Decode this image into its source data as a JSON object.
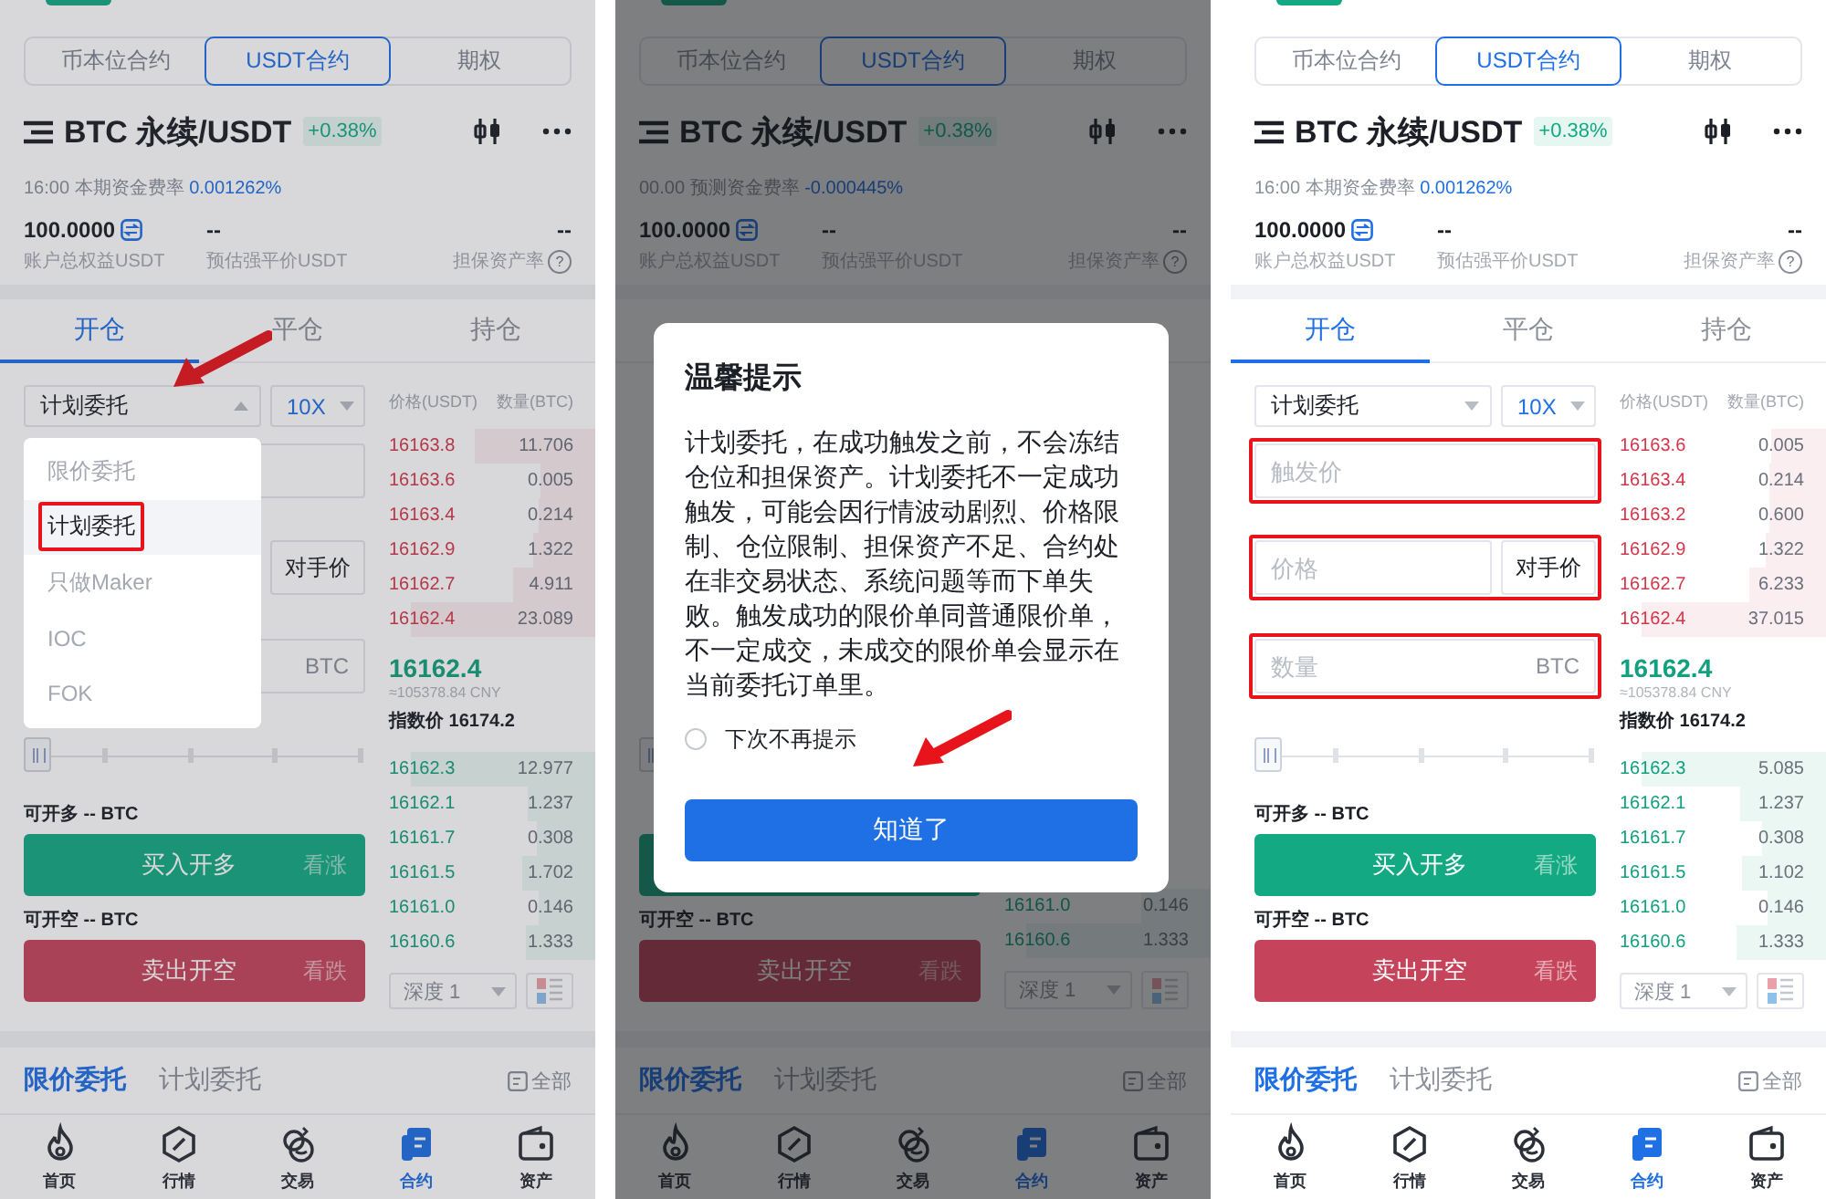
{
  "screens": [
    {
      "market_tabs": [
        {
          "label": "币本位合约",
          "selected": false
        },
        {
          "label": "USDT合约",
          "selected": true
        },
        {
          "label": "期权",
          "selected": false
        }
      ],
      "symbol": "BTC 永续/USDT",
      "change": "+0.38%",
      "funding": {
        "label": "16:00 本期资金费率",
        "rate": "0.001262%"
      },
      "stats": [
        {
          "value": "100.0000",
          "label": "账户总权益USDT"
        },
        {
          "value": "--",
          "label": "预估强平价USDT"
        },
        {
          "value": "--",
          "label": "担保资产率",
          "help": "?"
        }
      ],
      "trade_tabs": [
        {
          "label": "开仓",
          "selected": true
        },
        {
          "label": "平仓",
          "selected": false
        },
        {
          "label": "持仓",
          "selected": false
        }
      ],
      "order_type": {
        "value": "计划委托",
        "open": true,
        "arrow": true
      },
      "leverage": "10X",
      "trigger_field": {
        "highlighted": false
      },
      "price_field": {
        "highlighted": false
      },
      "counter_price": "对手价",
      "amount_field": {
        "unit": "BTC",
        "highlighted": false
      },
      "slider": {
        "level": 0
      },
      "long_available": "可开多 -- BTC",
      "buy": {
        "label": "买入开多",
        "hint": "看涨"
      },
      "short_available": "可开空 -- BTC",
      "sell": {
        "label": "卖出开空",
        "hint": "看跌"
      },
      "book_header": {
        "price": "价格(USDT)",
        "amount": "数量(BTC)"
      },
      "asks": [
        {
          "price": "16163.8",
          "amount": "11.706"
        },
        {
          "price": "16163.6",
          "amount": "0.005"
        },
        {
          "price": "16163.4",
          "amount": "0.214"
        },
        {
          "price": "16162.9",
          "amount": "1.322"
        },
        {
          "price": "16162.7",
          "amount": "4.911"
        },
        {
          "price": "16162.4",
          "amount": "23.089"
        }
      ],
      "last_price": "16162.4",
      "last_price_cny": "≈105378.84 CNY",
      "index_price": "指数价 16174.2",
      "bids": [
        {
          "price": "16162.3",
          "amount": "12.977"
        },
        {
          "price": "16162.1",
          "amount": "1.237"
        },
        {
          "price": "16161.7",
          "amount": "0.308"
        },
        {
          "price": "16161.5",
          "amount": "1.702"
        },
        {
          "price": "16161.0",
          "amount": "0.146"
        },
        {
          "price": "16160.6",
          "amount": "1.333"
        }
      ],
      "depth": "深度 1",
      "order_tabs": [
        {
          "label": "限价委托",
          "selected": true
        },
        {
          "label": "计划委托",
          "selected": false
        }
      ],
      "all_label": "全部",
      "nav": [
        {
          "label": "首页",
          "selected": false
        },
        {
          "label": "行情",
          "selected": false
        },
        {
          "label": "交易",
          "selected": false
        },
        {
          "label": "合约",
          "selected": true
        },
        {
          "label": "资产",
          "selected": false
        }
      ],
      "overlay": {
        "kind": "dropdown",
        "options": [
          {
            "label": "限价委托",
            "selected": false,
            "highlighted": false
          },
          {
            "label": "计划委托",
            "selected": true,
            "highlighted": true
          },
          {
            "label": "只做Maker",
            "selected": false,
            "highlighted": false
          },
          {
            "label": "IOC",
            "selected": false,
            "highlighted": false
          },
          {
            "label": "FOK",
            "selected": false,
            "highlighted": false
          }
        ]
      }
    },
    {
      "market_tabs": [
        {
          "label": "币本位合约",
          "selected": false
        },
        {
          "label": "USDT合约",
          "selected": true
        },
        {
          "label": "期权",
          "selected": false
        }
      ],
      "symbol": "BTC 永续/USDT",
      "change": "+0.38%",
      "funding": {
        "label": "00.00 预测资金费率",
        "rate": "-0.000445%"
      },
      "stats": [
        {
          "value": "100.0000",
          "label": "账户总权益USDT"
        },
        {
          "value": "--",
          "label": "预估强平价USDT"
        },
        {
          "value": "--",
          "label": "担保资产率",
          "help": "?"
        }
      ],
      "slider": {
        "level": 0
      },
      "short_available": "可开空 -- BTC",
      "sell": {
        "label": "卖出开空",
        "hint": "看跌"
      },
      "bids": [
        {
          "price": "16161.0",
          "amount": "0.146"
        },
        {
          "price": "16160.6",
          "amount": "1.333"
        }
      ],
      "depth": "深度 1",
      "order_tabs": [
        {
          "label": "限价委托",
          "selected": true
        },
        {
          "label": "计划委托",
          "selected": false
        }
      ],
      "all_label": "全部",
      "nav": [
        {
          "label": "首页",
          "selected": false
        },
        {
          "label": "行情",
          "selected": false
        },
        {
          "label": "交易",
          "selected": false
        },
        {
          "label": "合约",
          "selected": true
        },
        {
          "label": "资产",
          "selected": false
        }
      ],
      "overlay": {
        "kind": "dialog",
        "title": "温馨提示",
        "body": "计划委托，在成功触发之前，不会冻结仓位和担保资产。计划委托不一定成功触发，可能会因行情波动剧烈、价格限制、仓位限制、担保资产不足、合约处在非交易状态、系统问题等而下单失败。触发成功的限价单同普通限价单，不一定成交，未成交的限价单会显示在当前委托订单里。",
        "checkbox": {
          "label": "下次不再提示",
          "checked": false
        },
        "confirm": {
          "label": "知道了",
          "arrow": true
        }
      }
    },
    {
      "market_tabs": [
        {
          "label": "币本位合约",
          "selected": false
        },
        {
          "label": "USDT合约",
          "selected": true
        },
        {
          "label": "期权",
          "selected": false
        }
      ],
      "symbol": "BTC 永续/USDT",
      "change": "+0.38%",
      "funding": {
        "label": "16:00 本期资金费率",
        "rate": "0.001262%"
      },
      "stats": [
        {
          "value": "100.0000",
          "label": "账户总权益USDT"
        },
        {
          "value": "--",
          "label": "预估强平价USDT"
        },
        {
          "value": "--",
          "label": "担保资产率",
          "help": "?"
        }
      ],
      "trade_tabs": [
        {
          "label": "开仓",
          "selected": true
        },
        {
          "label": "平仓",
          "selected": false
        },
        {
          "label": "持仓",
          "selected": false
        }
      ],
      "order_type": {
        "value": "计划委托",
        "open": false,
        "arrow": false
      },
      "leverage": "10X",
      "trigger_field": {
        "placeholder": "触发价",
        "highlighted": true
      },
      "price_field": {
        "placeholder": "价格",
        "highlighted": true
      },
      "counter_price": "对手价",
      "amount_field": {
        "placeholder": "数量",
        "unit": "BTC",
        "highlighted": true
      },
      "slider": {
        "level": 0
      },
      "long_available": "可开多 -- BTC",
      "buy": {
        "label": "买入开多",
        "hint": "看涨"
      },
      "short_available": "可开空 -- BTC",
      "sell": {
        "label": "卖出开空",
        "hint": "看跌"
      },
      "book_header": {
        "price": "价格(USDT)",
        "amount": "数量(BTC)"
      },
      "asks": [
        {
          "price": "16163.6",
          "amount": "0.005"
        },
        {
          "price": "16163.4",
          "amount": "0.214"
        },
        {
          "price": "16163.2",
          "amount": "0.600"
        },
        {
          "price": "16162.9",
          "amount": "1.322"
        },
        {
          "price": "16162.7",
          "amount": "6.233"
        },
        {
          "price": "16162.4",
          "amount": "37.015"
        }
      ],
      "last_price": "16162.4",
      "last_price_cny": "≈105378.84 CNY",
      "index_price": "指数价 16174.2",
      "bids": [
        {
          "price": "16162.3",
          "amount": "5.085"
        },
        {
          "price": "16162.1",
          "amount": "1.237"
        },
        {
          "price": "16161.7",
          "amount": "0.308"
        },
        {
          "price": "16161.5",
          "amount": "1.102"
        },
        {
          "price": "16161.0",
          "amount": "0.146"
        },
        {
          "price": "16160.6",
          "amount": "1.333"
        }
      ],
      "depth": "深度 1",
      "order_tabs": [
        {
          "label": "限价委托",
          "selected": true
        },
        {
          "label": "计划委托",
          "selected": false
        }
      ],
      "all_label": "全部",
      "nav": [
        {
          "label": "首页",
          "selected": false
        },
        {
          "label": "行情",
          "selected": false
        },
        {
          "label": "交易",
          "selected": false
        },
        {
          "label": "合约",
          "selected": true
        },
        {
          "label": "资产",
          "selected": false
        }
      ]
    }
  ]
}
